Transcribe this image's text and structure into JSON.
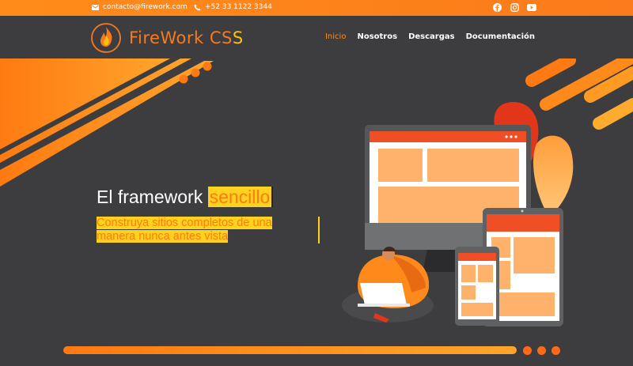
{
  "topbar": {
    "email": "contacto@firework.com",
    "phone": "+52 33 1122 3344",
    "socials": [
      "facebook-icon",
      "instagram-icon",
      "youtube-icon"
    ]
  },
  "brand": {
    "name_main": "FireWork CS",
    "name_last": "S"
  },
  "nav": {
    "items": [
      {
        "label": "Inicio",
        "active": true
      },
      {
        "label": "Nosotros",
        "active": false
      },
      {
        "label": "Descargas",
        "active": false
      },
      {
        "label": "Documentación",
        "active": false
      }
    ]
  },
  "hero": {
    "headline_prefix": "El framework ",
    "headline_highlight": "sencillo",
    "subline_1": "Construya sitios completos de una",
    "subline_2": "manera nunca antes vista"
  },
  "colors": {
    "accent": "#ff8c1a",
    "accent_dark": "#f47b20",
    "highlight": "#ffd21f",
    "background": "#3d3d3f"
  }
}
